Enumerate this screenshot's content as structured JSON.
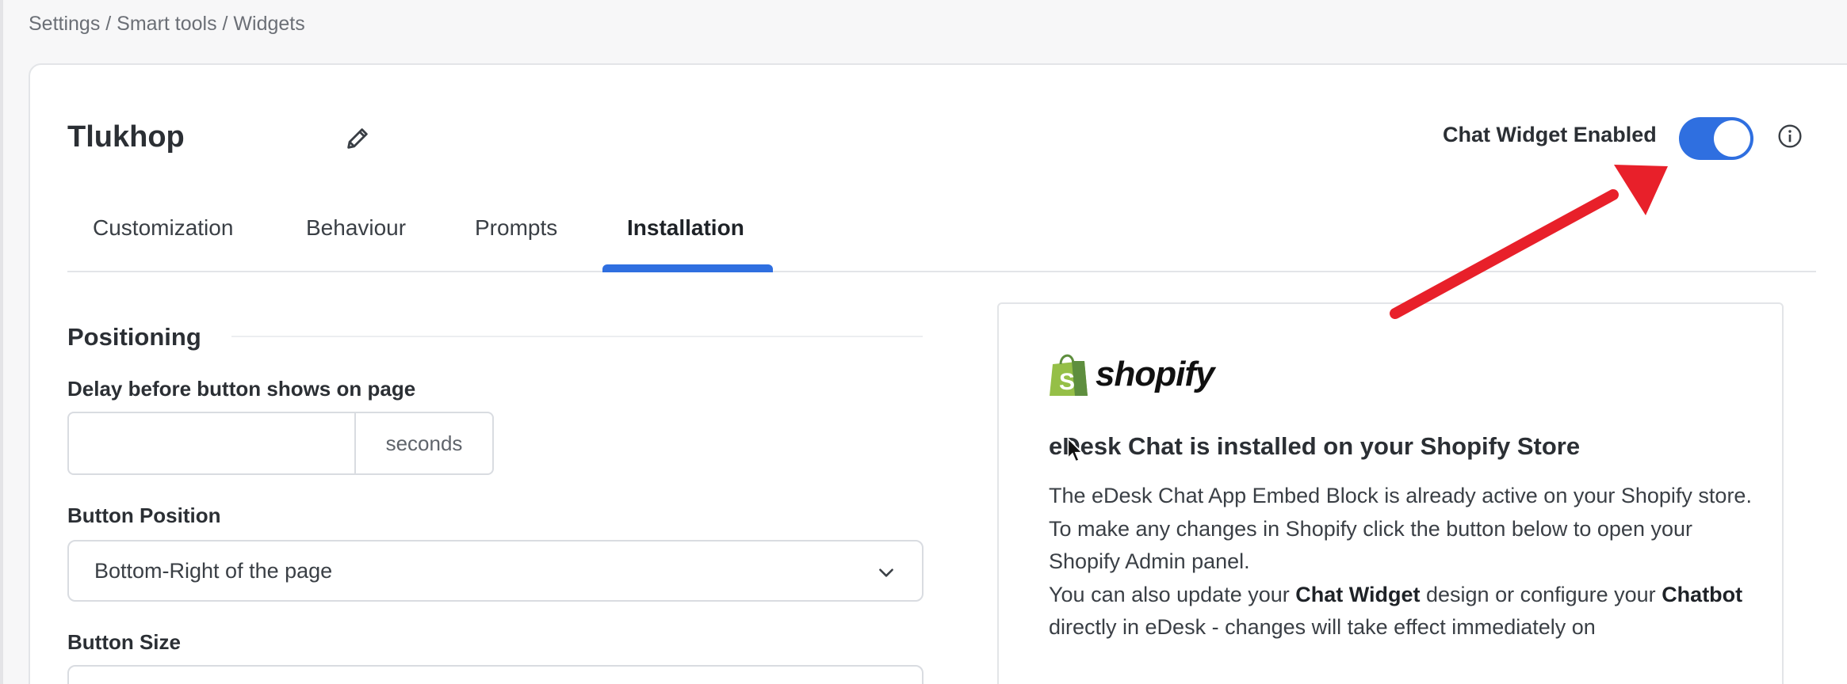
{
  "breadcrumb": "Settings / Smart tools / Widgets",
  "widget": {
    "name": "Tlukhop"
  },
  "toggle": {
    "label": "Chat Widget Enabled",
    "enabled": true,
    "accent": "#2f6fe0"
  },
  "tabs": [
    {
      "label": "Customization",
      "active": false
    },
    {
      "label": "Behaviour",
      "active": false
    },
    {
      "label": "Prompts",
      "active": false
    },
    {
      "label": "Installation",
      "active": true
    }
  ],
  "positioning": {
    "title": "Positioning",
    "delay_label": "Delay before button shows on page",
    "delay_value": "",
    "delay_suffix": "seconds",
    "position_label": "Button Position",
    "position_value": "Bottom-Right of the page",
    "size_label": "Button Size"
  },
  "shopify_panel": {
    "logo_text": "shopify",
    "heading": "eDesk Chat is installed on your Shopify Store",
    "para1": "The eDesk Chat App Embed Block is already active on your Shopify store.",
    "para2": "To make any changes in Shopify click the button below to open your Shopify Admin panel.",
    "para3_a": "You can also update your ",
    "para3_b": "Chat Widget",
    "para3_c": " design or configure your ",
    "para3_d": "Chatbot",
    "para3_e": " directly in eDesk - changes will take effect immediately on"
  },
  "icons": {
    "pencil": "pencil-icon",
    "info": "info-icon",
    "chevron": "chevron-down-icon",
    "shopify_bag": "shopify-bag-icon"
  },
  "annotation_color": "#e8202a"
}
